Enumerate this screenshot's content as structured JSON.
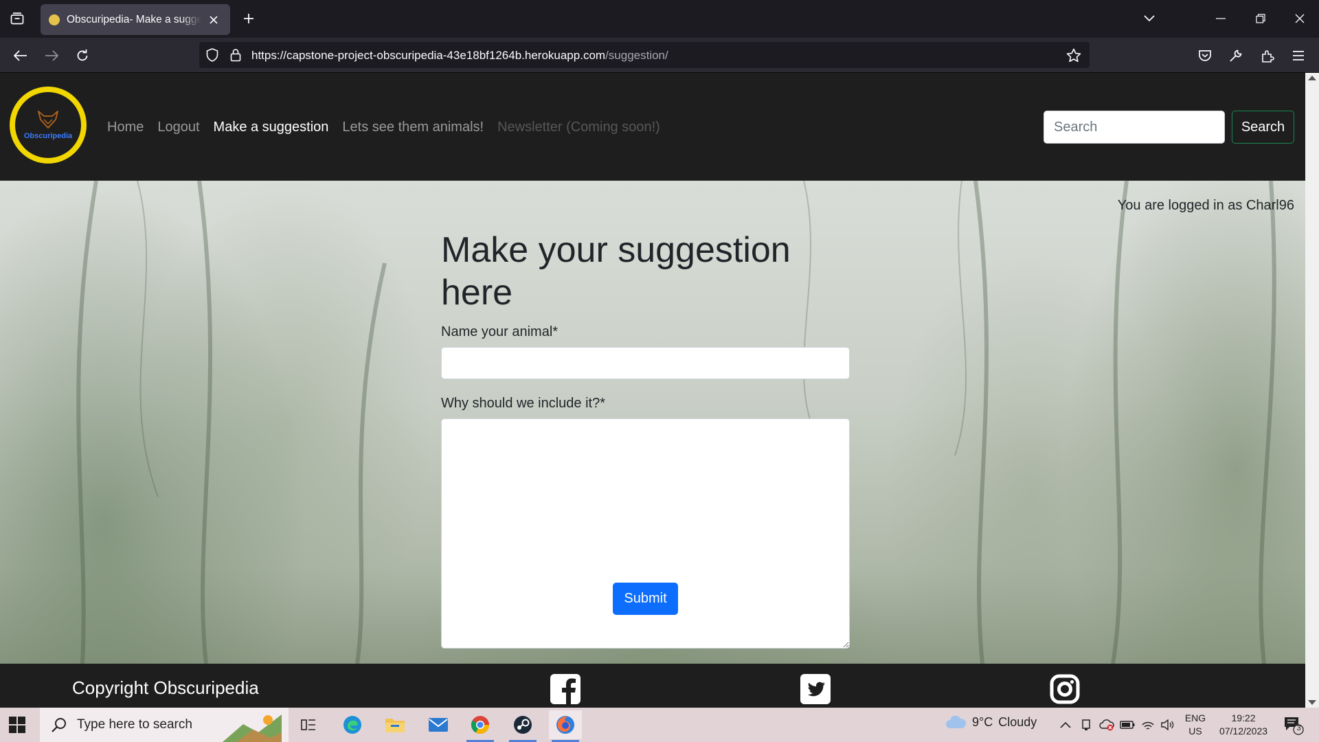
{
  "browser": {
    "tab": {
      "title": "Obscuripedia- Make a suggestion"
    },
    "url": {
      "host": "https://capstone-project-obscuripedia-43e18bf1264b.herokuapp.com",
      "path": "/suggestion/"
    }
  },
  "site": {
    "logo_text": "Obscuripedia",
    "nav": [
      {
        "label": "Home",
        "state": "normal"
      },
      {
        "label": "Logout",
        "state": "normal"
      },
      {
        "label": "Make a suggestion",
        "state": "active"
      },
      {
        "label": "Lets see them animals!",
        "state": "normal"
      },
      {
        "label": "Newsletter (Coming soon!)",
        "state": "disabled"
      }
    ],
    "search": {
      "placeholder": "Search",
      "button_label": "Search"
    },
    "accent_yellow": "#f2d600",
    "brand_blue": "#0d6efd"
  },
  "main": {
    "logged_in_text": "You are logged in as Charl96",
    "title": "Make your suggestion here",
    "name_label": "Name your animal*",
    "name_value": "",
    "reason_label": "Why should we include it?*",
    "reason_value": "",
    "submit_label": "Submit"
  },
  "footer": {
    "copyright": "Copyright Obscuripedia",
    "social_icons": [
      "facebook-icon",
      "twitter-icon",
      "instagram-icon"
    ]
  },
  "taskbar": {
    "search_placeholder": "Type here to search",
    "weather": {
      "temp": "9°C",
      "condition": "Cloudy"
    },
    "lang_line1": "ENG",
    "lang_line2": "US",
    "time": "19:22",
    "date": "07/12/2023",
    "notification_count": "3"
  }
}
